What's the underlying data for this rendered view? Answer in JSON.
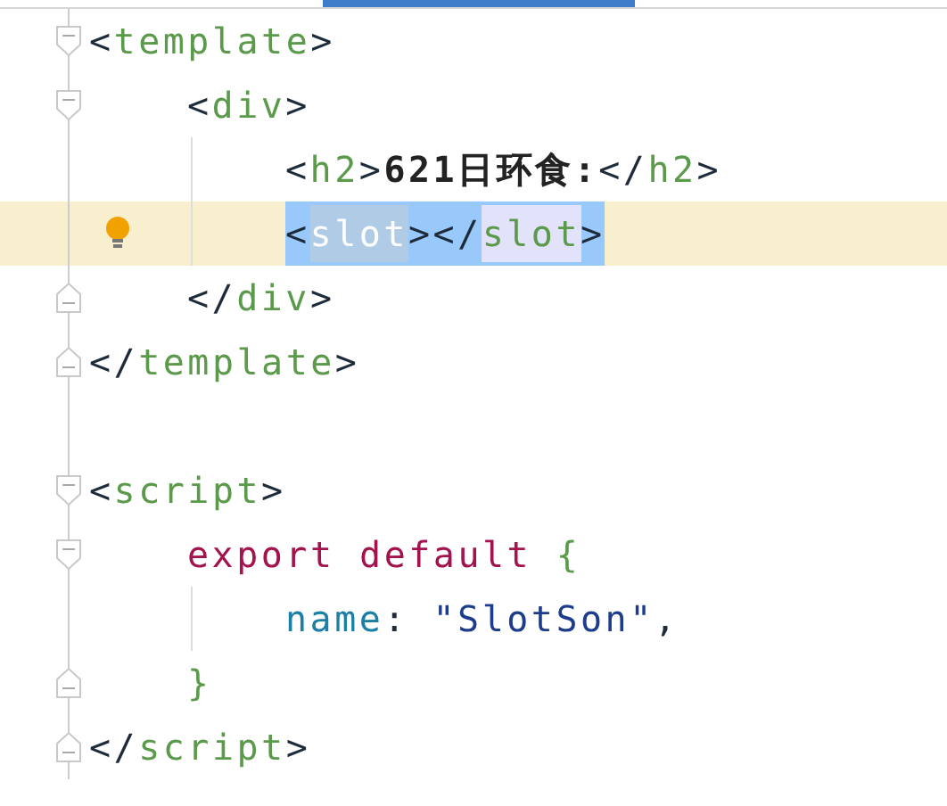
{
  "lines": [
    {
      "fold_start": true,
      "fold_end": false,
      "current": false,
      "bulb": false,
      "tokens": [
        {
          "kind": "punct",
          "text": "<"
        },
        {
          "kind": "tag",
          "text": "template"
        },
        {
          "kind": "punct",
          "text": ">"
        }
      ],
      "children": [
        {
          "fold_start": true,
          "fold_end": false,
          "current": false,
          "bulb": false,
          "tokens": [
            {
              "kind": "punct",
              "text": "<"
            },
            {
              "kind": "tag",
              "text": "div"
            },
            {
              "kind": "punct",
              "text": ">"
            }
          ],
          "children": [
            {
              "fold_start": false,
              "fold_end": false,
              "current": false,
              "bulb": false,
              "tokens": [
                {
                  "kind": "punct",
                  "text": "<"
                },
                {
                  "kind": "tag",
                  "text": "h2"
                },
                {
                  "kind": "punct",
                  "text": ">"
                },
                {
                  "kind": "bold",
                  "text": "621日环食:"
                },
                {
                  "kind": "punct",
                  "text": "</"
                },
                {
                  "kind": "tag",
                  "text": "h2"
                },
                {
                  "kind": "punct",
                  "text": ">"
                }
              ]
            },
            {
              "fold_start": false,
              "fold_end": false,
              "current": true,
              "bulb": true,
              "tokens": [
                {
                  "kind": "punct",
                  "text": "<",
                  "selected": true
                },
                {
                  "kind": "tag",
                  "text": "slot",
                  "selected": true,
                  "caret": true
                },
                {
                  "kind": "punct",
                  "text": "></",
                  "selected": true
                },
                {
                  "kind": "tag",
                  "text": "slot",
                  "selected": true,
                  "match": true
                },
                {
                  "kind": "punct",
                  "text": ">",
                  "selected": true
                }
              ]
            }
          ]
        },
        {
          "fold_start": false,
          "fold_end": true,
          "current": false,
          "bulb": false,
          "tokens": [
            {
              "kind": "punct",
              "text": "</"
            },
            {
              "kind": "tag",
              "text": "div"
            },
            {
              "kind": "punct",
              "text": ">"
            }
          ]
        }
      ]
    },
    {
      "fold_start": false,
      "fold_end": true,
      "current": false,
      "bulb": false,
      "tokens": [
        {
          "kind": "punct",
          "text": "</"
        },
        {
          "kind": "tag",
          "text": "template"
        },
        {
          "kind": "punct",
          "text": ">"
        }
      ]
    },
    {
      "fold_start": false,
      "fold_end": false,
      "current": false,
      "bulb": false
    },
    {
      "fold_start": true,
      "fold_end": false,
      "current": false,
      "bulb": false,
      "tokens": [
        {
          "kind": "punct",
          "text": "<"
        },
        {
          "kind": "tag",
          "text": "script"
        },
        {
          "kind": "punct",
          "text": ">"
        }
      ],
      "children": [
        {
          "fold_start": true,
          "fold_end": false,
          "current": false,
          "bulb": false,
          "tokens": [
            {
              "kind": "keyword",
              "text": "export default "
            },
            {
              "kind": "tag",
              "text": "{"
            }
          ],
          "children": [
            {
              "fold_start": false,
              "fold_end": false,
              "current": false,
              "bulb": false,
              "tokens": [
                {
                  "kind": "prop",
                  "text": "name"
                },
                {
                  "kind": "punct",
                  "text": ": "
                },
                {
                  "kind": "string",
                  "text": "\"SlotSon\""
                },
                {
                  "kind": "punct",
                  "text": ","
                }
              ]
            }
          ]
        },
        {
          "fold_start": false,
          "fold_end": true,
          "current": false,
          "bulb": false,
          "tokens": [
            {
              "kind": "tag",
              "text": "}"
            }
          ]
        }
      ]
    },
    {
      "fold_start": false,
      "fold_end": true,
      "current": false,
      "bulb": false,
      "tokens": [
        {
          "kind": "punct",
          "text": "</"
        },
        {
          "kind": "tag",
          "text": "script"
        },
        {
          "kind": "punct",
          "text": ">"
        }
      ]
    }
  ]
}
